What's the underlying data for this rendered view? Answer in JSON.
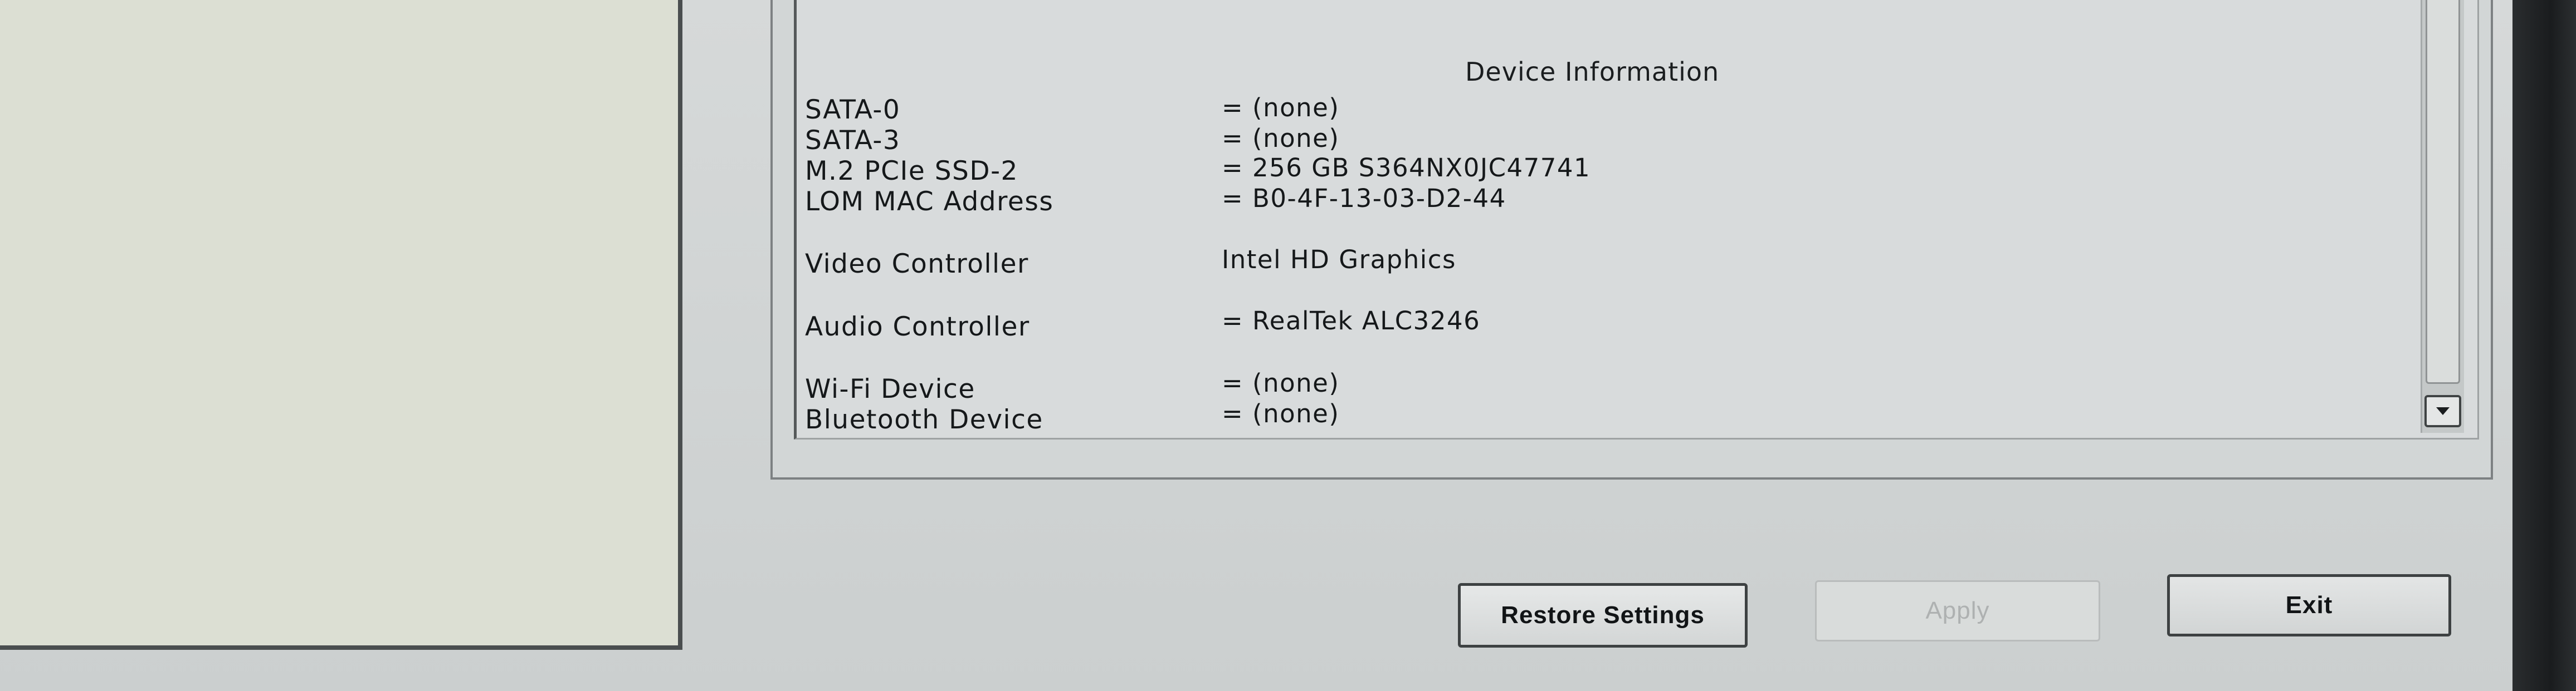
{
  "device_info": {
    "title": "Device Information",
    "rows": [
      {
        "label": "SATA-0",
        "value": "= (none)"
      },
      {
        "label": "SATA-3",
        "value": "= (none)"
      },
      {
        "label": "M.2 PCIe SSD-2",
        "value": "= 256 GB S364NX0JC47741"
      },
      {
        "label": "LOM MAC Address",
        "value": "= B0-4F-13-03-D2-44"
      },
      {
        "label": "Video Controller",
        "value": "Intel HD Graphics"
      },
      {
        "label": "Audio Controller",
        "value": "= RealTek ALC3246"
      },
      {
        "label": "Wi-Fi Device",
        "value": "= (none)"
      },
      {
        "label": "Bluetooth Device",
        "value": "= (none)"
      }
    ]
  },
  "buttons": {
    "restore_label": "Restore Settings",
    "apply_label": "Apply",
    "exit_label": "Exit"
  },
  "icons": {
    "scroll_down": "chevron-down-icon"
  }
}
